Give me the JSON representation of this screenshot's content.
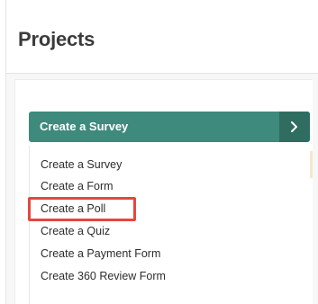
{
  "page": {
    "title": "Projects"
  },
  "create_button": {
    "label": "Create a Survey"
  },
  "menu": {
    "items": [
      {
        "label": "Create a Survey"
      },
      {
        "label": "Create a Form"
      },
      {
        "label": "Create a Poll",
        "highlighted": true
      },
      {
        "label": "Create a Quiz"
      },
      {
        "label": "Create a Payment Form"
      },
      {
        "label": "Create 360 Review Form"
      }
    ]
  },
  "icons": {
    "expand": "chevron-right-icon"
  },
  "colors": {
    "button": "#3e8a7c",
    "button_dark": "#2f6d61",
    "highlight": "#e5473d",
    "title_text": "#3b3b3b",
    "menu_text": "#2d2d2d"
  }
}
